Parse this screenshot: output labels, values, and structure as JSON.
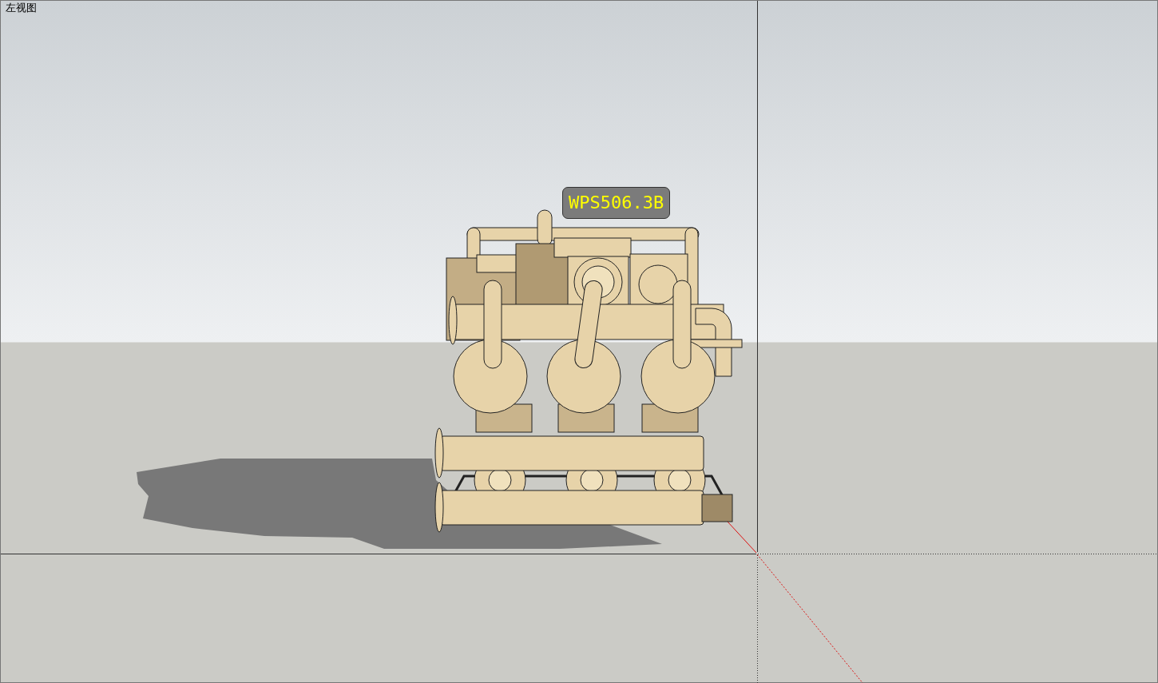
{
  "view": {
    "title": "左视图"
  },
  "model": {
    "label": "WPS506.3B"
  }
}
